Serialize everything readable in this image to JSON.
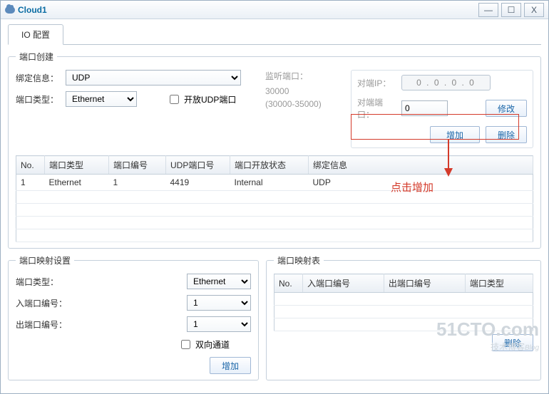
{
  "window": {
    "title": "Cloud1"
  },
  "tabs": {
    "io_config": "IO 配置"
  },
  "port_create": {
    "legend": "端口创建",
    "bind_info_label": "绑定信息：",
    "bind_info_value": "UDP",
    "port_type_label": "端口类型：",
    "port_type_value": "Ethernet",
    "open_udp_label": "开放UDP端口",
    "listen_port_label": "监听端口：",
    "listen_port_value": "30000",
    "listen_port_range": "(30000-35000)",
    "peer_ip_label": "对端IP：",
    "peer_ip_value": "0  .  0  .  0  .  0",
    "peer_port_label": "对端端口：",
    "peer_port_value": "0",
    "modify_btn": "修改",
    "add_btn": "增加",
    "delete_btn": "删除",
    "table": {
      "headers": {
        "no": "No.",
        "port_type": "端口类型",
        "port_num": "端口编号",
        "udp_num": "UDP端口号",
        "open_state": "端口开放状态",
        "bind_info": "绑定信息"
      },
      "rows": [
        {
          "no": "1",
          "port_type": "Ethernet",
          "port_num": "1",
          "udp_num": "4419",
          "open_state": "Internal",
          "bind_info": "UDP"
        }
      ]
    }
  },
  "port_map_settings": {
    "legend": "端口映射设置",
    "port_type_label": "端口类型：",
    "port_type_value": "Ethernet",
    "in_port_label": "入端口编号：",
    "in_port_value": "1",
    "out_port_label": "出端口编号：",
    "out_port_value": "1",
    "bidir_label": "双向通道",
    "add_btn": "增加"
  },
  "port_map_table": {
    "legend": "端口映射表",
    "headers": {
      "no": "No.",
      "in_port": "入端口编号",
      "out_port": "出端口编号",
      "port_type": "端口类型"
    },
    "delete_btn": "删除"
  },
  "annotation": {
    "text": "点击增加"
  },
  "watermark": {
    "big": "51CTO.com",
    "small": "技术博客",
    "suffix": "Blog"
  }
}
